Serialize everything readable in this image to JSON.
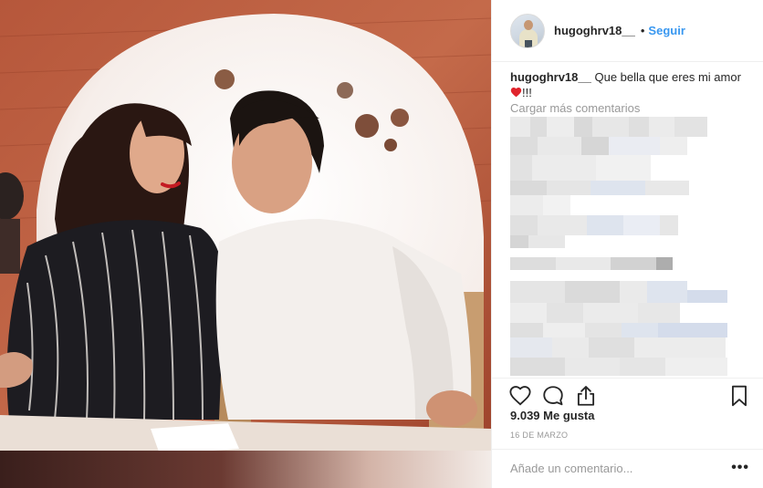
{
  "post": {
    "photo_alt": "",
    "author": "hugoghrv18__",
    "separator": "•",
    "follow_label": "Seguir",
    "caption_user": "hugoghrv18__",
    "caption_text": "Que bella que eres mi amor",
    "caption_suffix": "!!!",
    "load_more_label": "Cargar más comentarios",
    "likes_text": "9.039 Me gusta",
    "date_text": "16 DE MARZO",
    "comment_placeholder": "Añade un comentario...",
    "more_label": "•••"
  },
  "colors": {
    "accent": "#3897f0",
    "muted": "#999999",
    "text": "#262626",
    "heart": "#ed4956"
  },
  "icons": {
    "like": "heart-outline-icon",
    "comment": "speech-bubble-icon",
    "share": "share-upload-icon",
    "save": "bookmark-icon",
    "caption_emoji": "red-heart-emoji"
  }
}
